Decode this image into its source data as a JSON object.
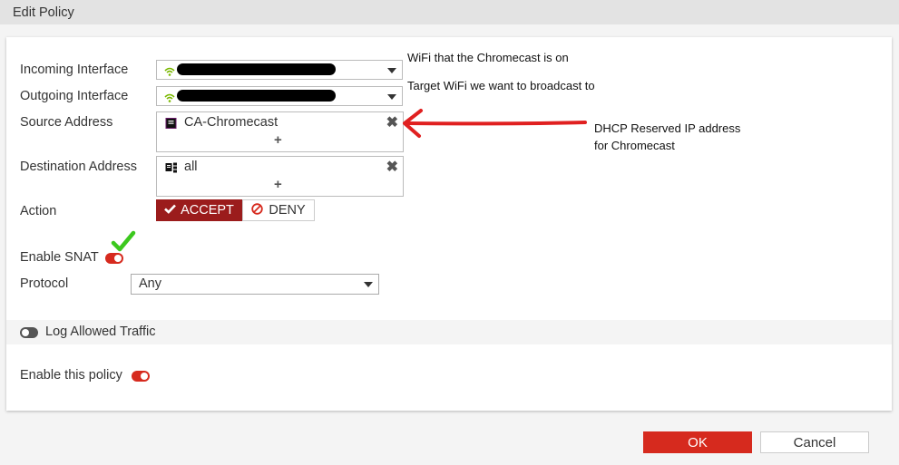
{
  "header": {
    "title": "Edit Policy"
  },
  "form": {
    "incoming_interface": {
      "label": "Incoming Interface",
      "icon": "wifi-icon",
      "value_redacted": true
    },
    "outgoing_interface": {
      "label": "Outgoing Interface",
      "icon": "wifi-icon",
      "value_redacted": true
    },
    "source_address": {
      "label": "Source Address",
      "items": [
        {
          "name": "CA-Chromecast",
          "icon": "address-icon"
        }
      ],
      "add": "+",
      "remove": "✖"
    },
    "destination_address": {
      "label": "Destination Address",
      "items": [
        {
          "name": "all",
          "icon": "address-group-icon"
        }
      ],
      "add": "+",
      "remove": "✖"
    },
    "action": {
      "label": "Action",
      "options": [
        "ACCEPT",
        "DENY"
      ],
      "selected": "ACCEPT"
    },
    "enable_snat": {
      "label": "Enable SNAT",
      "enabled": true
    },
    "protocol": {
      "label": "Protocol",
      "value": "Any"
    },
    "log_allowed_traffic": {
      "label": "Log Allowed Traffic",
      "enabled": false
    },
    "enable_policy": {
      "label": "Enable this policy",
      "enabled": true
    }
  },
  "annotations": {
    "incoming_note": "WiFi that the Chromecast is on",
    "outgoing_note": "Target WiFi we want to broadcast to",
    "source_note_line1": "DHCP Reserved IP address",
    "source_note_line2": "for Chromecast",
    "arrow_color": "#e02020",
    "check_color": "#3cc81e"
  },
  "footer": {
    "ok_label": "OK",
    "cancel_label": "Cancel"
  },
  "colors": {
    "accent": "#d62a1e",
    "accept_bg": "#9b1c1c",
    "wifi": "#7ab800"
  }
}
